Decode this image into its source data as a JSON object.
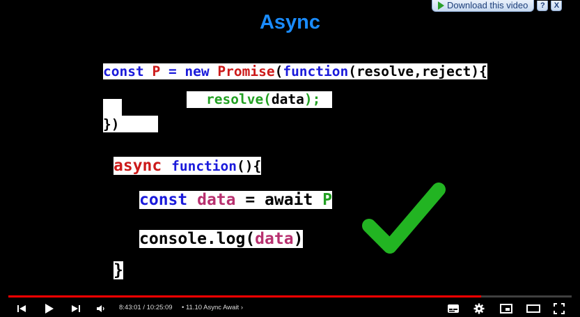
{
  "slide": {
    "title": "Async",
    "promise_code": {
      "kw_const": "const",
      "var_p": "P",
      "eq_new": " = new ",
      "promise": "Promise",
      "open": "(",
      "function_kw": "function",
      "params": "(resolve,reject){",
      "resolve": "resolve(",
      "data": "data",
      "resolve_end": ");",
      "close": "})"
    },
    "async_code": {
      "async": "async",
      "function_kw": "function",
      "paren": "(){",
      "const": "const",
      "data": "data",
      "await": "= await",
      "p": "P",
      "console": "console.log(",
      "data2": "data",
      "close_paren": ")",
      "close_brace": "}"
    },
    "check_color": "#22b422"
  },
  "download_bar": {
    "label": "Download this video",
    "help": "?",
    "close": "X"
  },
  "player": {
    "progress_fraction": 0.839,
    "time": "8:43:01 / 10:25:09",
    "chapter": "• 11.10 Async Await",
    "chapter_arrow": "›",
    "icons": [
      "previous-icon",
      "play-icon",
      "next-icon",
      "volume-icon",
      "subtitles-icon",
      "settings-icon",
      "miniplayer-icon",
      "theater-icon",
      "fullscreen-icon"
    ]
  }
}
